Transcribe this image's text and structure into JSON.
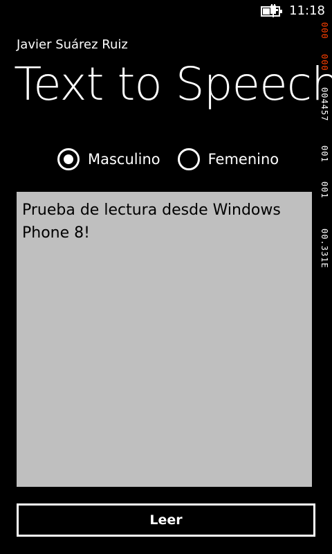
{
  "status_bar": {
    "time": "11:18",
    "battery_icon": "battery-charging-icon"
  },
  "perf_counter": {
    "rows": [
      {
        "text": "000",
        "color": "#ff4000"
      },
      {
        "text": "000",
        "color": "#ff4000"
      },
      {
        "text": "004457",
        "color": "#ffffff"
      },
      {
        "text": "001",
        "color": "#ffffff"
      },
      {
        "text": "001",
        "color": "#ffffff"
      },
      {
        "text": "00.331E",
        "color": "#ffffff"
      }
    ]
  },
  "header": {
    "app_name": "Javier Suárez Ruiz",
    "page_title": "Text to Speech"
  },
  "voice_options": {
    "selected": "Masculino",
    "options": [
      {
        "label": "Masculino",
        "checked": true
      },
      {
        "label": "Femenino",
        "checked": false
      }
    ]
  },
  "text_input": {
    "value": "Prueba de lectura desde Windows Phone 8!"
  },
  "actions": {
    "read_label": "Leer"
  },
  "colors": {
    "background": "#000000",
    "foreground": "#ffffff",
    "textbox_background": "#bfbfbf",
    "counter_accent": "#ff4000"
  }
}
